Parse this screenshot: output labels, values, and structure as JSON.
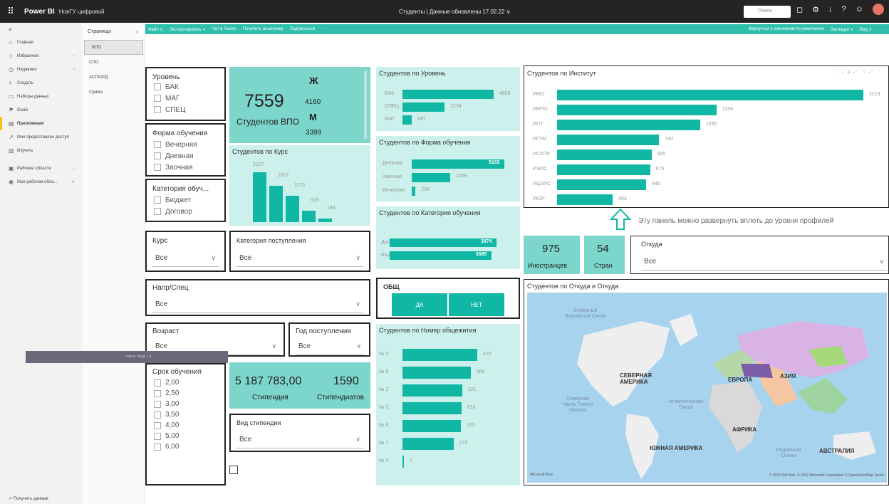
{
  "topbar": {
    "app": "Power BI",
    "workspace": "НовГУ цифровой",
    "report_title": "Студенты  |  Данные обновлены 17.02.22 ∨",
    "search_placeholder": "Поиск"
  },
  "toolbar": {
    "items": [
      "Файл ∨",
      "Экспортировать ∨",
      "Чат в Teams",
      "Получить аналитику",
      "Подписаться",
      "···"
    ],
    "right": [
      "Вернуться к значениям по умолчанию",
      "Закладки ∨",
      "Вид ∨"
    ]
  },
  "leftnav": {
    "items": [
      {
        "icon": "≡",
        "label": ""
      },
      {
        "icon": "⌂",
        "label": "Главная"
      },
      {
        "icon": "☆",
        "label": "Избранное",
        "chev": "›"
      },
      {
        "icon": "◷",
        "label": "Недавние",
        "chev": "›"
      },
      {
        "icon": "+",
        "label": "Создать"
      },
      {
        "icon": "▭",
        "label": "Наборы данных"
      },
      {
        "icon": "⚑",
        "label": "Goals"
      },
      {
        "icon": "▤",
        "label": "Приложения",
        "active": true
      },
      {
        "icon": "↗",
        "label": "Мне предоставлен доступ"
      },
      {
        "icon": "▥",
        "label": "Изучить"
      },
      {
        "icon": "▣",
        "label": "Рабочие области",
        "chev": "›"
      },
      {
        "icon": "◉",
        "label": "Моя рабочая обла...",
        "chev": "∨"
      }
    ],
    "get_data": "Получить данные"
  },
  "pages": {
    "header": "Страницы",
    "collapse": "«",
    "items": [
      "ВПО",
      "СПО",
      "АСП/ОРД",
      "Сумма"
    ]
  },
  "level": {
    "title": "Уровень",
    "options": [
      "БАК",
      "МАГ",
      "СПЕЦ"
    ]
  },
  "form": {
    "title": "Форма обучения",
    "options": [
      "Вечерняя",
      "Дневная",
      "Заочная"
    ]
  },
  "category": {
    "title": "Категория обуч...",
    "options": [
      "Бюджет",
      "Договор"
    ]
  },
  "total": {
    "value": "7559",
    "label": "Студентов  ВПО",
    "f_label": "Ж",
    "f_value": "4160",
    "m_label": "М",
    "m_value": "3399"
  },
  "course_chart": {
    "title": "Студентов по Курс"
  },
  "course_slicer": {
    "title": "Курс",
    "value": "Все"
  },
  "admission_cat": {
    "title": "Категория поступления",
    "value": "Все"
  },
  "direction": {
    "title": "Напр/Спец",
    "value": "Все"
  },
  "age": {
    "title": "Возраст",
    "value": "Все"
  },
  "year": {
    "title": "Год поступления",
    "value": "Все"
  },
  "term": {
    "title": "Срок обучения",
    "options": [
      "2,00",
      "2,50",
      "3,00",
      "3,50",
      "4,00",
      "5,00",
      "6,00"
    ]
  },
  "stipend": {
    "amount": "5 187 783,00",
    "amount_label": "Стипендия",
    "count": "1590",
    "count_label": "Стипендиатов"
  },
  "stipend_type": {
    "title": "Вид стипендии",
    "value": "Все"
  },
  "overlay_text": "новые люди 1 в",
  "level_chart": {
    "title": "Студентов по Уровень"
  },
  "form_chart": {
    "title": "Студентов по Форма обучения"
  },
  "cat_chart": {
    "title": "Студентов по Категория обучения"
  },
  "dorm": {
    "title": "ОБЩ",
    "yes": "ДА",
    "no": "НЕТ"
  },
  "dorm_chart": {
    "title": "Студентов по Номер общежития"
  },
  "inst_chart": {
    "title": "Студентов по Институт",
    "note": "Эту панель можно развернуть вплоть до уровня профилей"
  },
  "foreign": {
    "value": "975",
    "label": "Иностранцев",
    "countries": "54",
    "countries_label": "Стран"
  },
  "origin": {
    "title": "Откуда",
    "value": "Все"
  },
  "map": {
    "title": "Студентов по Откуда и Откуда",
    "labels": [
      "Северный Ледовитый Океан",
      "СЕВЕРНАЯ АМЕРИКА",
      "Северная Часть Тихого Океана",
      "Атлантический Океан",
      "ЕВРОПА",
      "АЗИЯ",
      "АФРИКА",
      "ЮЖНАЯ АМЕРИКА",
      "Индийский Океан",
      "АВСТРАЛИЯ"
    ],
    "logo": "Microsoft Bing",
    "copyright": "© 2022 TomTom, © 2022 Microsoft Corporation © OpenStreetMap Terms"
  },
  "chart_data": [
    {
      "type": "bar",
      "title": "Студентов по Курс",
      "categories": [
        "1",
        "2",
        "3",
        "4",
        "5",
        "6"
      ],
      "values": [
        2227,
        1627,
        1173,
        519,
        168,
        0
      ]
    },
    {
      "type": "bar",
      "title": "Студентов по Уровень",
      "categories": [
        "БАК",
        "СПЕЦ",
        "МАГ"
      ],
      "values": [
        4828,
        2234,
        497
      ]
    },
    {
      "type": "bar",
      "title": "Студентов по Форма обучения",
      "categories": [
        "Дневная",
        "Заочная",
        "Вечерняя"
      ],
      "values": [
        5183,
        2168,
        208
      ]
    },
    {
      "type": "bar",
      "title": "Студентов по Категория обучения",
      "categories": [
        "Договор",
        "Бюджет"
      ],
      "values": [
        3874,
        3685
      ]
    },
    {
      "type": "bar",
      "title": "Студентов по Номер общежития",
      "categories": [
        "№ 5",
        "№ 8",
        "№ 2",
        "№ 3",
        "№ 6",
        "№ 1",
        "№ 4"
      ],
      "values": [
        402,
        366,
        321,
        316,
        315,
        275,
        1
      ]
    },
    {
      "type": "bar",
      "title": "Студентов по Институт",
      "categories": [
        "ИМО",
        "ИНПО",
        "ИПТ",
        "ИГУМ",
        "ИСХПР",
        "ИЭИС",
        "ИЦЭУС",
        "ИЮР"
      ],
      "values": [
        2219,
        1156,
        1035,
        740,
        685,
        675,
        646,
        403
      ]
    }
  ]
}
